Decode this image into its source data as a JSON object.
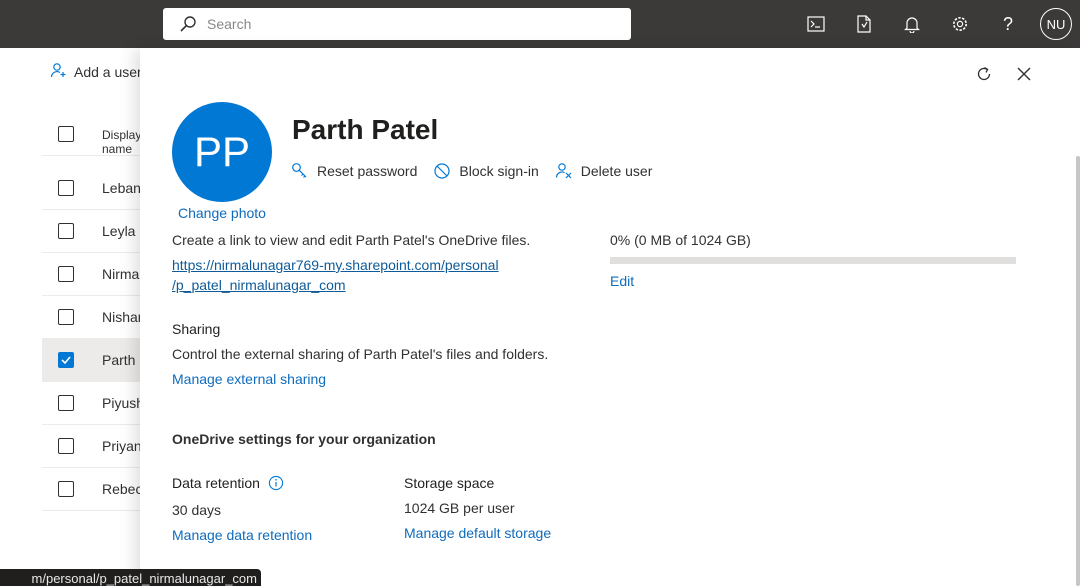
{
  "topbar": {
    "search_placeholder": "Search",
    "icons": [
      "terminal-icon",
      "document-icon",
      "bell-icon",
      "gear-icon",
      "help-icon"
    ],
    "account_initials": "NU"
  },
  "user_list": {
    "add_user_label": "Add a user",
    "column_header": "Display name",
    "rows": [
      {
        "name": "Lebanon",
        "checked": false
      },
      {
        "name": "Leyla G",
        "checked": false
      },
      {
        "name": "Nirmal",
        "checked": false
      },
      {
        "name": "Nishant",
        "checked": false
      },
      {
        "name": "Parth Patel",
        "checked": true
      },
      {
        "name": "Piyush",
        "checked": false
      },
      {
        "name": "Priyanka",
        "checked": false
      },
      {
        "name": "Rebecca",
        "checked": false
      }
    ]
  },
  "panel": {
    "avatar_initials": "PP",
    "change_photo": "Change photo",
    "user_name": "Parth Patel",
    "actions": {
      "reset_password": "Reset password",
      "block_signin": "Block sign-in",
      "delete_user": "Delete user"
    },
    "onedrive": {
      "description": "Create a link to view and edit Parth Patel's OneDrive files.",
      "link_line1": "https://nirmalunagar769-my.sharepoint.com/personal",
      "link_line2": "/p_patel_nirmalunagar_com",
      "storage_text": "0% (0 MB of 1024 GB)",
      "storage_used_fraction": 0,
      "edit": "Edit"
    },
    "sharing": {
      "title": "Sharing",
      "description": "Control the external sharing of Parth Patel's files and folders.",
      "manage_link": "Manage external sharing"
    },
    "org_settings": {
      "title": "OneDrive settings for your organization",
      "data_retention": {
        "title": "Data retention",
        "value": "30 days",
        "link": "Manage data retention"
      },
      "storage_space": {
        "title": "Storage space",
        "value": "1024 GB per user",
        "link": "Manage default storage"
      }
    }
  },
  "status_tooltip": "m/personal/p_patel_nirmalunagar_com",
  "colors": {
    "topbar": "#3b3a39",
    "accent": "#0078d4",
    "link": "#0f6cbd"
  }
}
